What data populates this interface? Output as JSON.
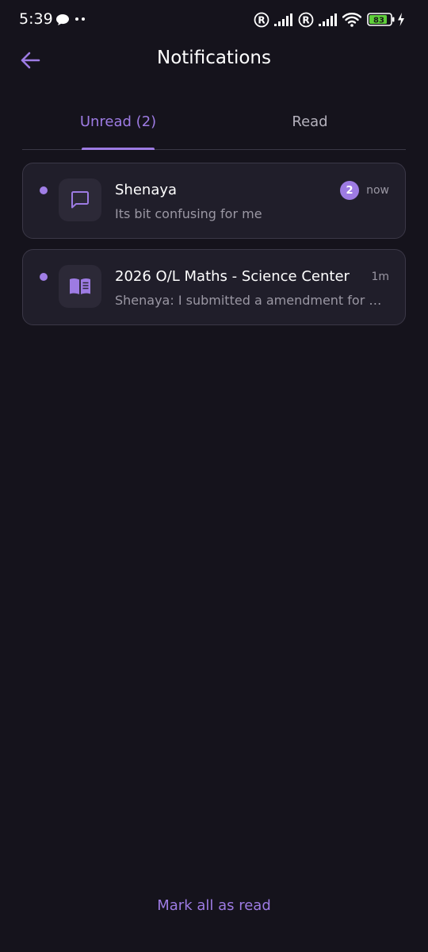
{
  "status_bar": {
    "time": "5:39",
    "battery_level": "83",
    "icons": [
      "chat-bubble-icon",
      "more-dots-icon",
      "registered-icon",
      "signal-icon",
      "registered-icon",
      "signal-icon",
      "wifi-icon",
      "battery-icon",
      "charging-icon"
    ]
  },
  "header": {
    "title": "Notifications",
    "back_icon": "arrow-left-icon"
  },
  "tabs": [
    {
      "label": "Unread (2)",
      "active": true
    },
    {
      "label": "Read",
      "active": false
    }
  ],
  "notifications": [
    {
      "title": "Shenaya",
      "message": "Its bit confusing for me",
      "time": "now",
      "badge_count": "2",
      "icon": "message-square-icon",
      "unread": true
    },
    {
      "title": "2026 O/L Maths - Science Center",
      "message": "Shenaya: I submitted a amendment for …",
      "time": "1m",
      "icon": "book-open-icon",
      "unread": true
    }
  ],
  "footer": {
    "mark_all_label": "Mark all as read"
  },
  "colors": {
    "background": "#15131c",
    "card": "#201e2a",
    "accent": "#9d7be3",
    "muted_text": "#9a97a3"
  }
}
